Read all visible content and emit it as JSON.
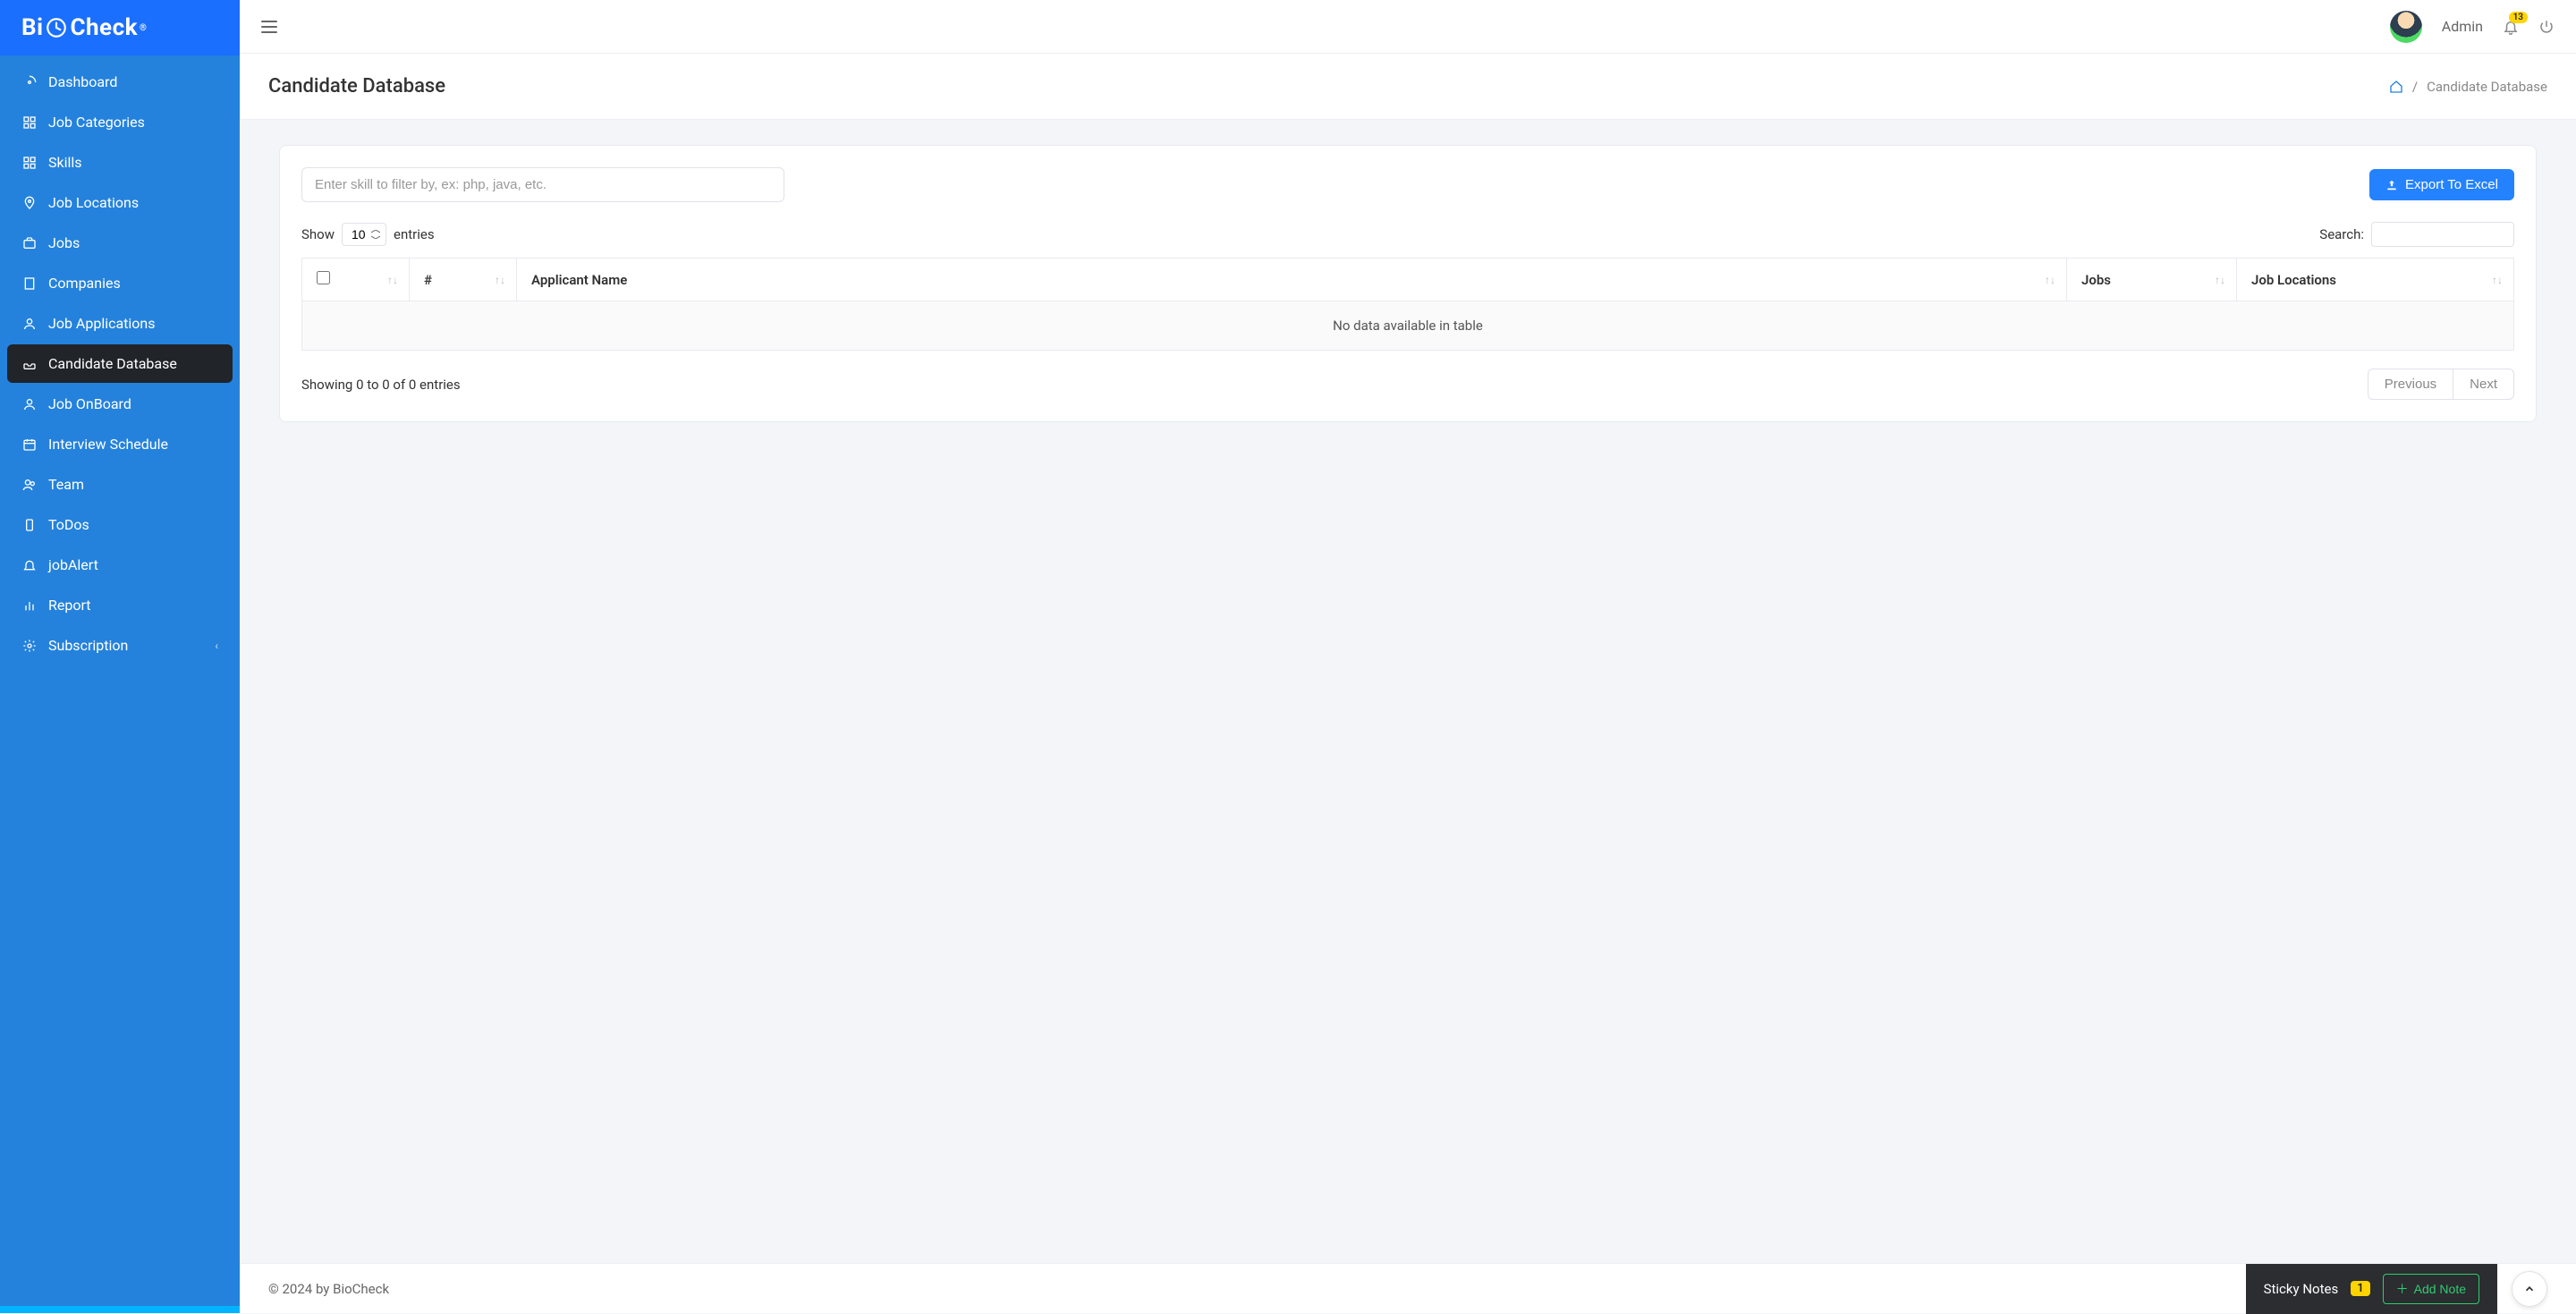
{
  "brand": {
    "name": "BiOCheck"
  },
  "topbar": {
    "user_name": "Admin",
    "notification_count": "13"
  },
  "sidebar": {
    "items": [
      {
        "label": "Dashboard",
        "icon": "gauge"
      },
      {
        "label": "Job Categories",
        "icon": "grid"
      },
      {
        "label": "Skills",
        "icon": "grid"
      },
      {
        "label": "Job Locations",
        "icon": "pin"
      },
      {
        "label": "Jobs",
        "icon": "suitcase"
      },
      {
        "label": "Companies",
        "icon": "building"
      },
      {
        "label": "Job Applications",
        "icon": "user"
      },
      {
        "label": "Candidate Database",
        "icon": "inbox",
        "active": true
      },
      {
        "label": "Job OnBoard",
        "icon": "user"
      },
      {
        "label": "Interview Schedule",
        "icon": "calendar"
      },
      {
        "label": "Team",
        "icon": "users"
      },
      {
        "label": "ToDos",
        "icon": "phone"
      },
      {
        "label": "jobAlert",
        "icon": "bell"
      },
      {
        "label": "Report",
        "icon": "chart"
      },
      {
        "label": "Subscription",
        "icon": "gear",
        "chevron": true
      }
    ]
  },
  "page": {
    "title": "Candidate Database",
    "breadcrumb_sep": "/",
    "breadcrumb_current": "Candidate Database"
  },
  "panel": {
    "filter_placeholder": "Enter skill to filter by, ex: php, java, etc.",
    "export_label": " Export To Excel",
    "show_label": "Show",
    "entries_label": "entries",
    "entries_value": "10",
    "search_label": "Search:",
    "columns": {
      "col1": "#",
      "col2": "Applicant Name",
      "col3": "Jobs",
      "col4": "Job Locations"
    },
    "empty_text": "No data available in table",
    "info_text": "Showing 0 to 0 of 0 entries",
    "prev_label": "Previous",
    "next_label": "Next"
  },
  "footer": {
    "copyright": "© 2024 by BioCheck",
    "sticky_label": "Sticky Notes",
    "sticky_count": "1",
    "add_note_label": "Add Note"
  }
}
